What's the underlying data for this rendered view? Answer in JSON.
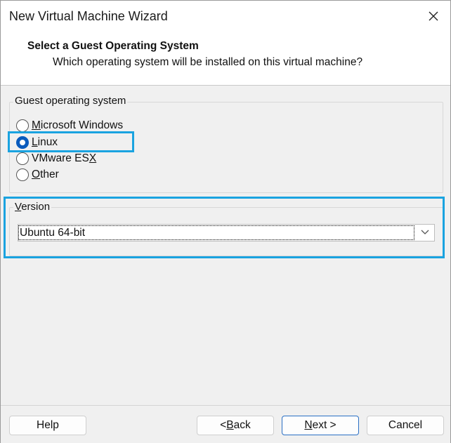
{
  "window": {
    "title": "New Virtual Machine Wizard"
  },
  "header": {
    "heading": "Select a Guest Operating System",
    "subheading": "Which operating system will be installed on this virtual machine?"
  },
  "guest_os": {
    "group_label": "Guest operating system",
    "options": [
      {
        "pre": "",
        "u": "M",
        "post": "icrosoft Windows",
        "checked": false
      },
      {
        "pre": "",
        "u": "L",
        "post": "inux",
        "checked": true
      },
      {
        "pre": "VMware ES",
        "u": "X",
        "post": "",
        "checked": false
      },
      {
        "pre": "",
        "u": "O",
        "post": "ther",
        "checked": false
      }
    ]
  },
  "version": {
    "label_u": "V",
    "label_rest": "ersion",
    "selected": "Ubuntu 64-bit"
  },
  "buttons": {
    "help": "Help",
    "back_pre": "< ",
    "back_u": "B",
    "back_post": "ack",
    "next_u": "N",
    "next_post": "ext >",
    "cancel": "Cancel"
  },
  "colors": {
    "highlight": "#1aa3e0",
    "radio_checked": "#0a5bbd"
  }
}
